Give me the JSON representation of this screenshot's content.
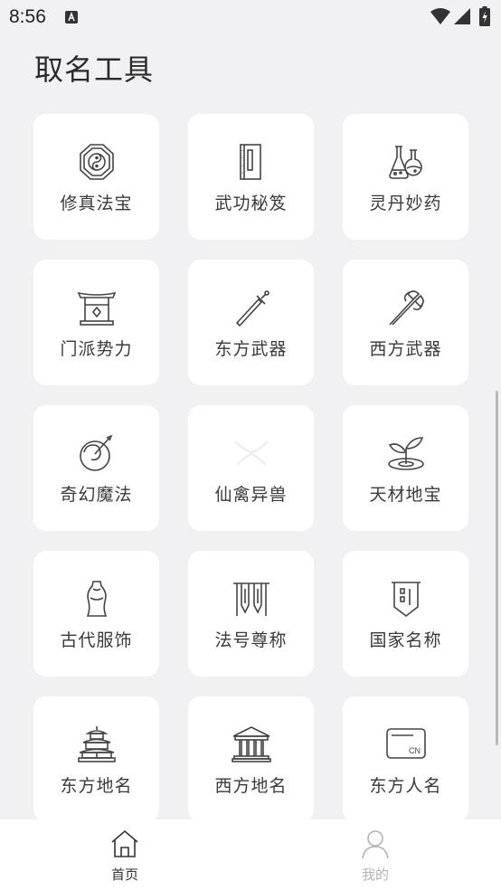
{
  "status_bar": {
    "time": "8:56"
  },
  "page": {
    "title": "取名工具"
  },
  "tools": [
    {
      "label": "修真法宝",
      "icon": "bagua-icon"
    },
    {
      "label": "武功秘笈",
      "icon": "book-icon"
    },
    {
      "label": "灵丹妙药",
      "icon": "potion-flasks-icon"
    },
    {
      "label": "门派势力",
      "icon": "sect-gate-icon"
    },
    {
      "label": "东方武器",
      "icon": "sword-icon"
    },
    {
      "label": "西方武器",
      "icon": "battle-axe-icon"
    },
    {
      "label": "奇幻魔法",
      "icon": "magic-orb-icon"
    },
    {
      "label": "仙禽异兽",
      "icon": "mythical-beast-icon"
    },
    {
      "label": "天材地宝",
      "icon": "sprout-icon"
    },
    {
      "label": "古代服饰",
      "icon": "qipao-icon"
    },
    {
      "label": "法号尊称",
      "icon": "banner-icon"
    },
    {
      "label": "国家名称",
      "icon": "national-flag-icon"
    },
    {
      "label": "东方地名",
      "icon": "pagoda-icon"
    },
    {
      "label": "西方地名",
      "icon": "temple-columns-icon"
    },
    {
      "label": "东方人名",
      "icon": "id-card-icon"
    }
  ],
  "id_card_badge": "CN",
  "bottom_nav": {
    "home": {
      "label": "首页",
      "icon": "home-icon",
      "active": true
    },
    "mine": {
      "label": "我的",
      "icon": "user-icon",
      "active": false
    }
  }
}
